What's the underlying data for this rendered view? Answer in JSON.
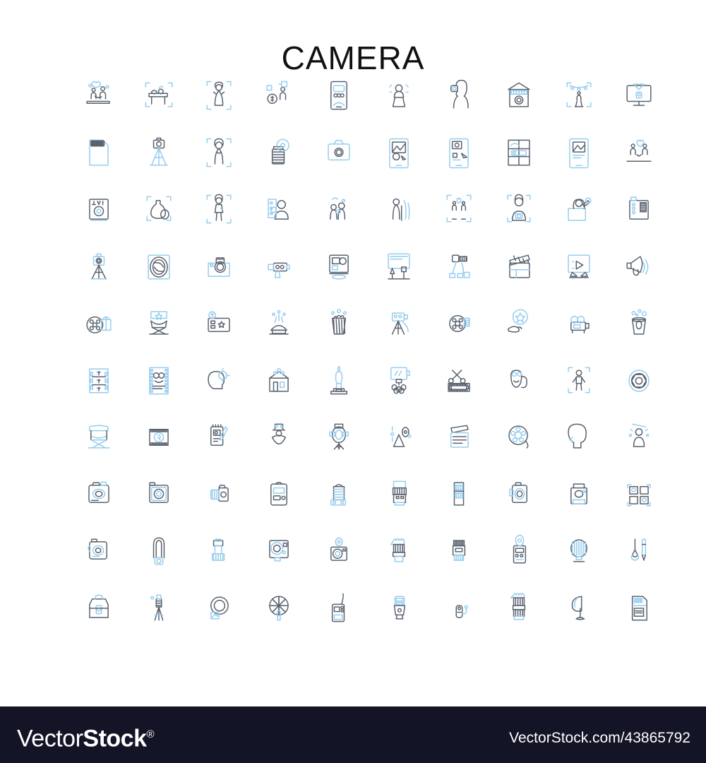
{
  "page": {
    "title": "CAMERA",
    "background_color": "#ffffff"
  },
  "palette": {
    "icon_dark": "#5b636f",
    "icon_accent": "#96cdee",
    "footer_background": "#131426",
    "footer_text": "#ffffff",
    "title_color": "#111111"
  },
  "grid": {
    "columns": 10,
    "rows": 10,
    "total_icons": 100
  },
  "icons": [
    {
      "row": 1,
      "col": 1,
      "name": "couple-proposal-icon"
    },
    {
      "row": 1,
      "col": 2,
      "name": "desk-product-shot-icon"
    },
    {
      "row": 1,
      "col": 3,
      "name": "bride-portrait-frame-icon"
    },
    {
      "row": 1,
      "col": 4,
      "name": "paid-photoshoot-icon"
    },
    {
      "row": 1,
      "col": 5,
      "name": "mobile-photo-app-icon"
    },
    {
      "row": 1,
      "col": 6,
      "name": "speaker-podium-icon"
    },
    {
      "row": 1,
      "col": 7,
      "name": "woman-selfie-icon"
    },
    {
      "row": 1,
      "col": 8,
      "name": "photo-studio-shop-icon"
    },
    {
      "row": 1,
      "col": 9,
      "name": "stage-performer-icon"
    },
    {
      "row": 1,
      "col": 10,
      "name": "desktop-photo-upload-icon"
    },
    {
      "row": 2,
      "col": 1,
      "name": "sd-memory-card-icon"
    },
    {
      "row": 2,
      "col": 2,
      "name": "camera-on-tripod-icon"
    },
    {
      "row": 2,
      "col": 3,
      "name": "portrait-model-frame-icon"
    },
    {
      "row": 2,
      "col": 4,
      "name": "film-canister-icon"
    },
    {
      "row": 2,
      "col": 5,
      "name": "compact-camera-icon"
    },
    {
      "row": 2,
      "col": 6,
      "name": "phone-photo-edit-icon"
    },
    {
      "row": 2,
      "col": 7,
      "name": "phone-photo-settings-icon"
    },
    {
      "row": 2,
      "col": 8,
      "name": "photo-grid-window-icon"
    },
    {
      "row": 2,
      "col": 9,
      "name": "phone-gallery-icon"
    },
    {
      "row": 2,
      "col": 10,
      "name": "couple-photo-session-icon"
    },
    {
      "row": 3,
      "col": 1,
      "name": "raw-format-file-icon"
    },
    {
      "row": 3,
      "col": 2,
      "name": "studio-vase-stilllife-icon"
    },
    {
      "row": 3,
      "col": 3,
      "name": "fashion-model-frame-icon"
    },
    {
      "row": 3,
      "col": 4,
      "name": "corporate-headshot-icon"
    },
    {
      "row": 3,
      "col": 5,
      "name": "family-outdoor-shoot-icon"
    },
    {
      "row": 3,
      "col": 6,
      "name": "senior-portrait-icon"
    },
    {
      "row": 3,
      "col": 7,
      "name": "couple-engagement-frame-icon"
    },
    {
      "row": 3,
      "col": 8,
      "name": "photographer-portrait-frame-icon"
    },
    {
      "row": 3,
      "col": 9,
      "name": "woman-phone-photo-icon"
    },
    {
      "row": 3,
      "col": 10,
      "name": "film-scanner-icon"
    },
    {
      "row": 4,
      "col": 1,
      "name": "camera-tripod-setup-icon"
    },
    {
      "row": 4,
      "col": 2,
      "name": "lens-aperture-icon"
    },
    {
      "row": 4,
      "col": 3,
      "name": "vintage-camera-frame-icon"
    },
    {
      "row": 4,
      "col": 4,
      "name": "video-camera-rig-icon"
    },
    {
      "row": 4,
      "col": 5,
      "name": "photo-editing-tablet-icon"
    },
    {
      "row": 4,
      "col": 6,
      "name": "studio-lighting-setup-icon"
    },
    {
      "row": 4,
      "col": 7,
      "name": "film-production-set-icon"
    },
    {
      "row": 4,
      "col": 8,
      "name": "clapperboard-icon"
    },
    {
      "row": 4,
      "col": 9,
      "name": "video-playback-screen-icon"
    },
    {
      "row": 4,
      "col": 10,
      "name": "megaphone-icon"
    },
    {
      "row": 5,
      "col": 1,
      "name": "film-reel-gift-icon"
    },
    {
      "row": 5,
      "col": 2,
      "name": "director-chair-star-icon"
    },
    {
      "row": 5,
      "col": 3,
      "name": "movie-ticket-icon"
    },
    {
      "row": 5,
      "col": 4,
      "name": "premiere-stage-icon"
    },
    {
      "row": 5,
      "col": 5,
      "name": "popcorn-bucket-icon"
    },
    {
      "row": 5,
      "col": 6,
      "name": "cinema-camera-tripod-icon"
    },
    {
      "row": 5,
      "col": 7,
      "name": "film-reel-projector-icon"
    },
    {
      "row": 5,
      "col": 8,
      "name": "star-award-hand-icon"
    },
    {
      "row": 5,
      "col": 9,
      "name": "movie-projector-icon"
    },
    {
      "row": 5,
      "col": 10,
      "name": "popcorn-drink-icon"
    },
    {
      "row": 6,
      "col": 1,
      "name": "film-budget-strip-icon"
    },
    {
      "row": 6,
      "col": 2,
      "name": "film-strip-masks-icon"
    },
    {
      "row": 6,
      "col": 3,
      "name": "idea-head-icon"
    },
    {
      "row": 6,
      "col": 4,
      "name": "cinema-building-icon"
    },
    {
      "row": 6,
      "col": 5,
      "name": "award-statue-icon"
    },
    {
      "row": 6,
      "col": 6,
      "name": "studio-monitor-light-icon"
    },
    {
      "row": 6,
      "col": 7,
      "name": "film-editing-scissors-icon"
    },
    {
      "row": 6,
      "col": 8,
      "name": "theatre-masks-icon"
    },
    {
      "row": 6,
      "col": 9,
      "name": "full-body-frame-icon"
    },
    {
      "row": 6,
      "col": 10,
      "name": "aperture-shutter-icon"
    },
    {
      "row": 7,
      "col": 1,
      "name": "folding-director-chair-icon"
    },
    {
      "row": 7,
      "col": 2,
      "name": "film-strip-rating-icon"
    },
    {
      "row": 7,
      "col": 3,
      "name": "storyboard-notepad-icon"
    },
    {
      "row": 7,
      "col": 4,
      "name": "magician-performer-icon"
    },
    {
      "row": 7,
      "col": 5,
      "name": "studio-spotlight-stand-icon"
    },
    {
      "row": 7,
      "col": 6,
      "name": "light-meter-cone-icon"
    },
    {
      "row": 7,
      "col": 7,
      "name": "clapperboard-script-icon"
    },
    {
      "row": 7,
      "col": 8,
      "name": "film-reel-tape-icon"
    },
    {
      "row": 7,
      "col": 9,
      "name": "head-profile-icon"
    },
    {
      "row": 7,
      "col": 10,
      "name": "portrait-lighting-icon"
    },
    {
      "row": 8,
      "col": 1,
      "name": "dslr-camera-front-icon"
    },
    {
      "row": 8,
      "col": 2,
      "name": "camera-body-back-icon"
    },
    {
      "row": 8,
      "col": 3,
      "name": "camera-side-lens-icon"
    },
    {
      "row": 8,
      "col": 4,
      "name": "dslr-body-top-icon"
    },
    {
      "row": 8,
      "col": 5,
      "name": "telephoto-lens-rig-icon"
    },
    {
      "row": 8,
      "col": 6,
      "name": "prime-lens-icon"
    },
    {
      "row": 8,
      "col": 7,
      "name": "zoom-lens-icon"
    },
    {
      "row": 8,
      "col": 8,
      "name": "mirrorless-camera-icon"
    },
    {
      "row": 8,
      "col": 9,
      "name": "photo-printer-icon"
    },
    {
      "row": 8,
      "col": 10,
      "name": "photo-collage-frames-icon"
    },
    {
      "row": 9,
      "col": 1,
      "name": "camera-with-strap-icon"
    },
    {
      "row": 9,
      "col": 2,
      "name": "camera-neck-strap-icon"
    },
    {
      "row": 9,
      "col": 3,
      "name": "flash-unit-icon"
    },
    {
      "row": 9,
      "col": 4,
      "name": "action-camera-icon"
    },
    {
      "row": 9,
      "col": 5,
      "name": "instant-camera-icon"
    },
    {
      "row": 9,
      "col": 6,
      "name": "lens-with-hood-icon"
    },
    {
      "row": 9,
      "col": 7,
      "name": "macro-lens-icon"
    },
    {
      "row": 9,
      "col": 8,
      "name": "light-meter-device-icon"
    },
    {
      "row": 9,
      "col": 9,
      "name": "softbox-light-icon"
    },
    {
      "row": 9,
      "col": 10,
      "name": "lens-cleaning-tools-icon"
    },
    {
      "row": 10,
      "col": 1,
      "name": "camera-bag-icon"
    },
    {
      "row": 10,
      "col": 2,
      "name": "folded-tripod-icon"
    },
    {
      "row": 10,
      "col": 3,
      "name": "lens-filter-ring-icon"
    },
    {
      "row": 10,
      "col": 4,
      "name": "shutter-blades-icon"
    },
    {
      "row": 10,
      "col": 5,
      "name": "remote-trigger-icon"
    },
    {
      "row": 10,
      "col": 6,
      "name": "lens-cap-hood-icon"
    },
    {
      "row": 10,
      "col": 7,
      "name": "shutter-release-cable-icon"
    },
    {
      "row": 10,
      "col": 8,
      "name": "lens-stack-icon"
    },
    {
      "row": 10,
      "col": 9,
      "name": "reflector-umbrella-icon"
    },
    {
      "row": 10,
      "col": 10,
      "name": "memory-card-reader-icon"
    }
  ],
  "footer": {
    "logo_light": "Vector",
    "logo_bold": "Stock",
    "logo_registered": "®",
    "url": "VectorStock.com/43865792"
  }
}
